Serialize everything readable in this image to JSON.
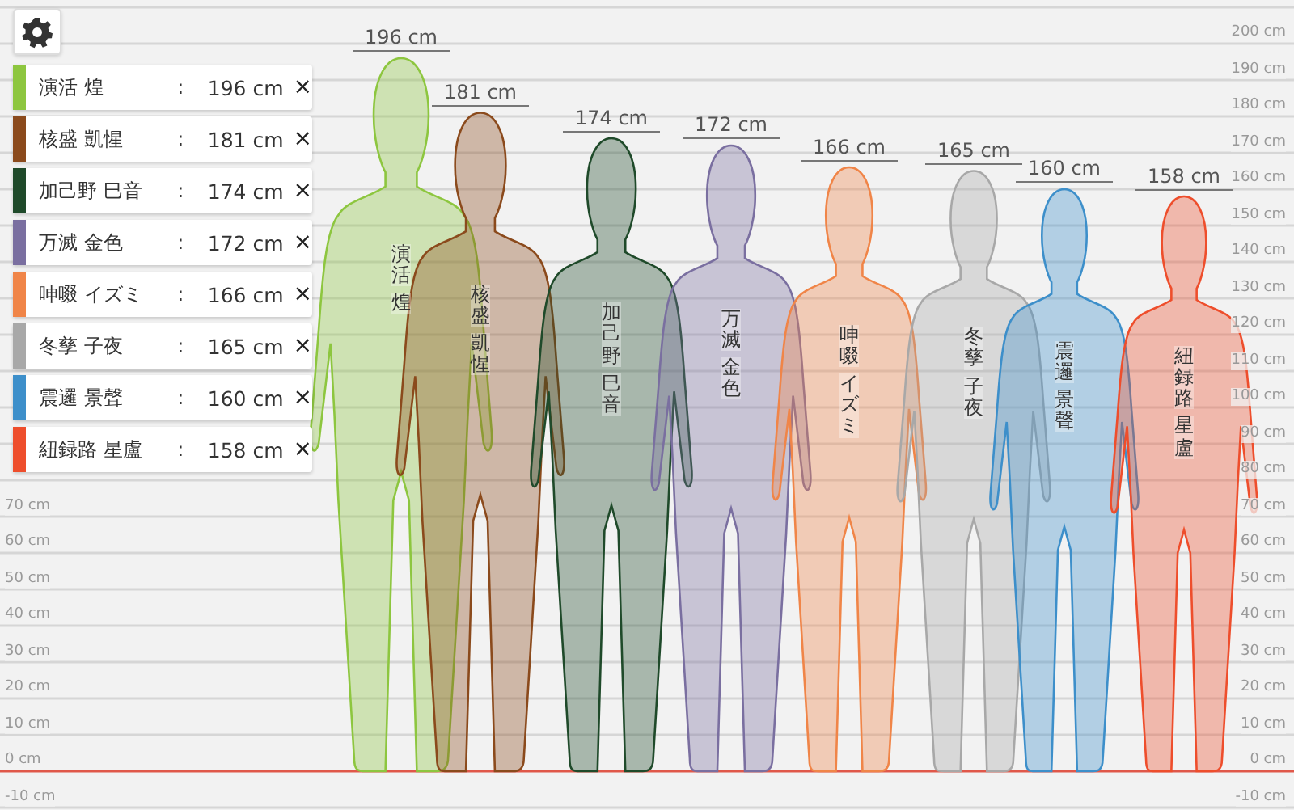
{
  "people": [
    {
      "name": "演活 煌",
      "height": "196 cm",
      "color": "#8dc63f"
    },
    {
      "name": "核盛 凱惺",
      "height": "181 cm",
      "color": "#8b4a1c"
    },
    {
      "name": "加己野 巳音",
      "height": "174 cm",
      "color": "#1f4a2a"
    },
    {
      "name": "万滅 金色",
      "height": "172 cm",
      "color": "#7a6fa0"
    },
    {
      "name": "呻啜 イズミ",
      "height": "166 cm",
      "color": "#f08548"
    },
    {
      "name": "冬孳 子夜",
      "height": "165 cm",
      "color": "#a8a8a8"
    },
    {
      "name": "震邏 景聲",
      "height": "160 cm",
      "color": "#3d8fca"
    },
    {
      "name": "紐録路 星盧",
      "height": "158 cm",
      "color": "#ee4e2c"
    }
  ],
  "figures": [
    {
      "name_lines": [
        "演活",
        "煌"
      ],
      "height": "196 cm",
      "color": "#8dc63f"
    },
    {
      "name_lines": [
        "核盛",
        "凱惺"
      ],
      "height": "181 cm",
      "color": "#8b4a1c"
    },
    {
      "name_lines": [
        "加己野",
        "巳音"
      ],
      "height": "174 cm",
      "color": "#1f4a2a"
    },
    {
      "name_lines": [
        "万滅",
        "金色"
      ],
      "height": "172 cm",
      "color": "#7a6fa0"
    },
    {
      "name_lines": [
        "呻啜",
        "イズミ"
      ],
      "height": "166 cm",
      "color": "#f08548"
    },
    {
      "name_lines": [
        "冬孳",
        "子夜"
      ],
      "height": "165 cm",
      "color": "#a8a8a8"
    },
    {
      "name_lines": [
        "震邏",
        "景聲"
      ],
      "height": "160 cm",
      "color": "#3d8fca"
    },
    {
      "name_lines": [
        "紐録路",
        "星盧"
      ],
      "height": "158 cm",
      "color": "#ee4e2c"
    }
  ],
  "remove_mark": "×",
  "separator": ":",
  "scale_left": [
    "70 cm",
    "60 cm",
    "50 cm",
    "40 cm",
    "30 cm",
    "20 cm",
    "10 cm",
    "0 cm",
    "-10 cm"
  ],
  "scale_right": [
    "200 cm",
    "190 cm",
    "180 cm",
    "170 cm",
    "160 cm",
    "150 cm",
    "140 cm",
    "130 cm",
    "120 cm",
    "110 cm",
    "100 cm",
    "90 cm",
    "80 cm",
    "70 cm",
    "60 cm",
    "50 cm",
    "40 cm",
    "30 cm",
    "20 cm",
    "10 cm",
    "0 cm",
    "-10 cm"
  ]
}
